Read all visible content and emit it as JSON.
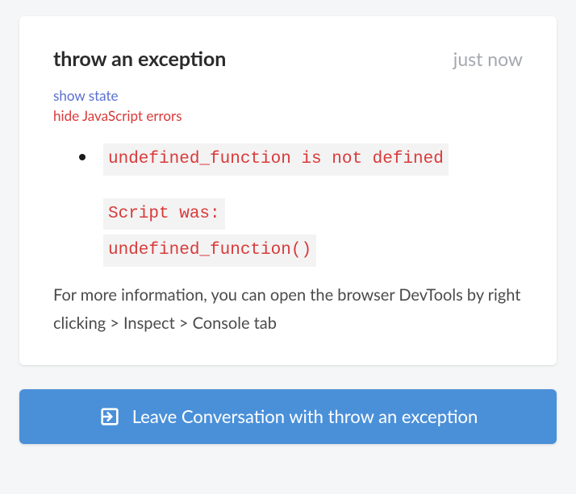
{
  "card": {
    "title": "throw an exception",
    "timestamp": "just now",
    "links": {
      "show_state": "show state",
      "hide_errors": "hide JavaScript errors"
    },
    "error": {
      "message": "undefined_function is not defined",
      "script_label": "Script was:",
      "script_body": "undefined_function()"
    },
    "info_text": "For more information, you can open the browser DevTools by right clicking > Inspect > Console tab"
  },
  "leave_button": {
    "label": "Leave Conversation with throw an exception"
  }
}
